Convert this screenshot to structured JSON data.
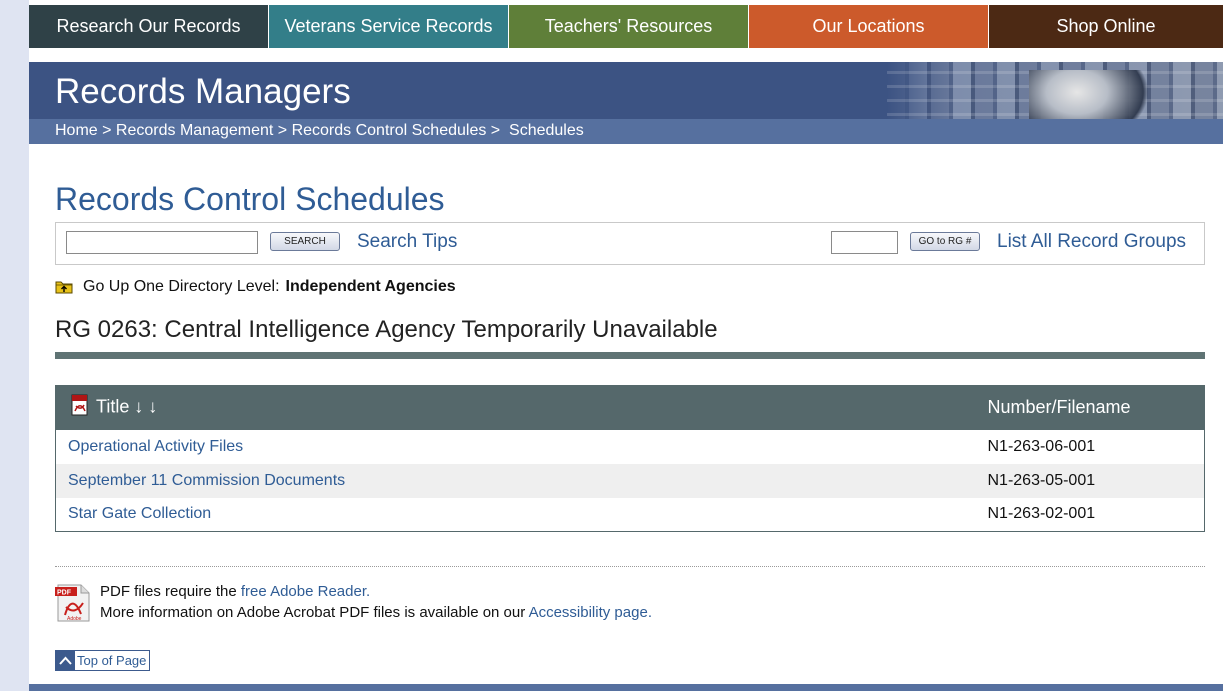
{
  "nav": {
    "tabs": [
      {
        "label": "Research Our Records",
        "color": "#2f4147"
      },
      {
        "label": "Veterans Service Records",
        "color": "#337e89"
      },
      {
        "label": "Teachers' Resources",
        "color": "#5f7f39"
      },
      {
        "label": "Our Locations",
        "color": "#cc5a2b"
      },
      {
        "label": "Shop Online",
        "color": "#4c2914"
      }
    ]
  },
  "banner": {
    "title": "Records Managers",
    "breadcrumb": {
      "home": "Home",
      "sep1": " > ",
      "records_management": "Records Management",
      "sep2": " > ",
      "records_control_schedules": "Records Control Schedules",
      "sep3": " >  ",
      "schedules": "Schedules"
    }
  },
  "main": {
    "heading": "Records Control Schedules",
    "search": {
      "input_value": "",
      "button_label": "SEARCH",
      "tips_label": "Search Tips",
      "rg_input_value": "",
      "rg_button_label": "GO to RG #",
      "list_all_label": "List All Record Groups"
    },
    "go_up": {
      "label": "Go Up One Directory Level:",
      "target": "Independent Agencies"
    },
    "rg_heading": "RG 0263: Central Intelligence Agency Temporarily Unavailable",
    "table": {
      "columns": {
        "title": "Title ↓ ↓",
        "number": "Number/Filename"
      },
      "rows": [
        {
          "title": "Operational Activity Files",
          "number": "N1-263-06-001"
        },
        {
          "title": "September 11 Commission Documents",
          "number": "N1-263-05-001"
        },
        {
          "title": "Star Gate Collection",
          "number": "N1-263-02-001"
        }
      ]
    }
  },
  "footer": {
    "pdf_line1_prefix": "PDF files require the ",
    "pdf_line1_link": "free Adobe Reader",
    "pdf_line1_suffix": ".",
    "pdf_line2_prefix": "More information on Adobe Acrobat PDF files is available on our ",
    "pdf_line2_link": "Accessibility page",
    "pdf_line2_suffix": ".",
    "pdf_icon_label": "Adobe",
    "top_of_page": "Top of Page"
  }
}
